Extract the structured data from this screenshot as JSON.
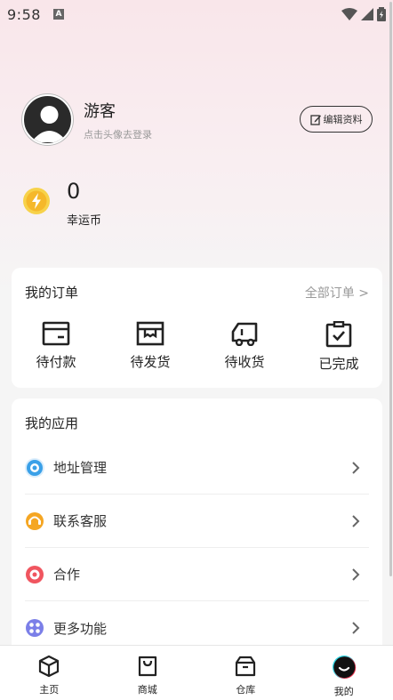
{
  "status_bar": {
    "time": "9:58",
    "notif_letter": "A"
  },
  "profile": {
    "name": "游客",
    "hint": "点击头像去登录",
    "edit_label": "编辑资料"
  },
  "coins": {
    "count": "0",
    "label": "幸运币"
  },
  "orders": {
    "title": "我的订单",
    "all_label": "全部订单 >",
    "items": [
      {
        "label": "待付款",
        "icon": "wallet-icon"
      },
      {
        "label": "待发货",
        "icon": "package-icon"
      },
      {
        "label": "待收货",
        "icon": "truck-icon"
      },
      {
        "label": "已完成",
        "icon": "clipboard-check-icon"
      }
    ]
  },
  "apps": {
    "title": "我的应用",
    "items": [
      {
        "label": "地址管理",
        "icon": "address-icon",
        "color": "#3aa0e8"
      },
      {
        "label": "联系客服",
        "icon": "service-icon",
        "color": "#f5a623"
      },
      {
        "label": "合作",
        "icon": "cooperation-icon",
        "color": "#f0555f"
      },
      {
        "label": "更多功能",
        "icon": "more-icon",
        "color": "#7b7fe8"
      }
    ]
  },
  "tabbar": {
    "items": [
      {
        "label": "主页",
        "icon": "cube-icon"
      },
      {
        "label": "商城",
        "icon": "shopping-bag-icon"
      },
      {
        "label": "仓库",
        "icon": "box-icon"
      },
      {
        "label": "我的",
        "icon": "profile-icon",
        "active": true
      }
    ]
  },
  "colors": {
    "accent_red": "#e8344e",
    "accent_cyan": "#27d3e0",
    "text_dark": "#222222",
    "text_muted": "#999999"
  }
}
